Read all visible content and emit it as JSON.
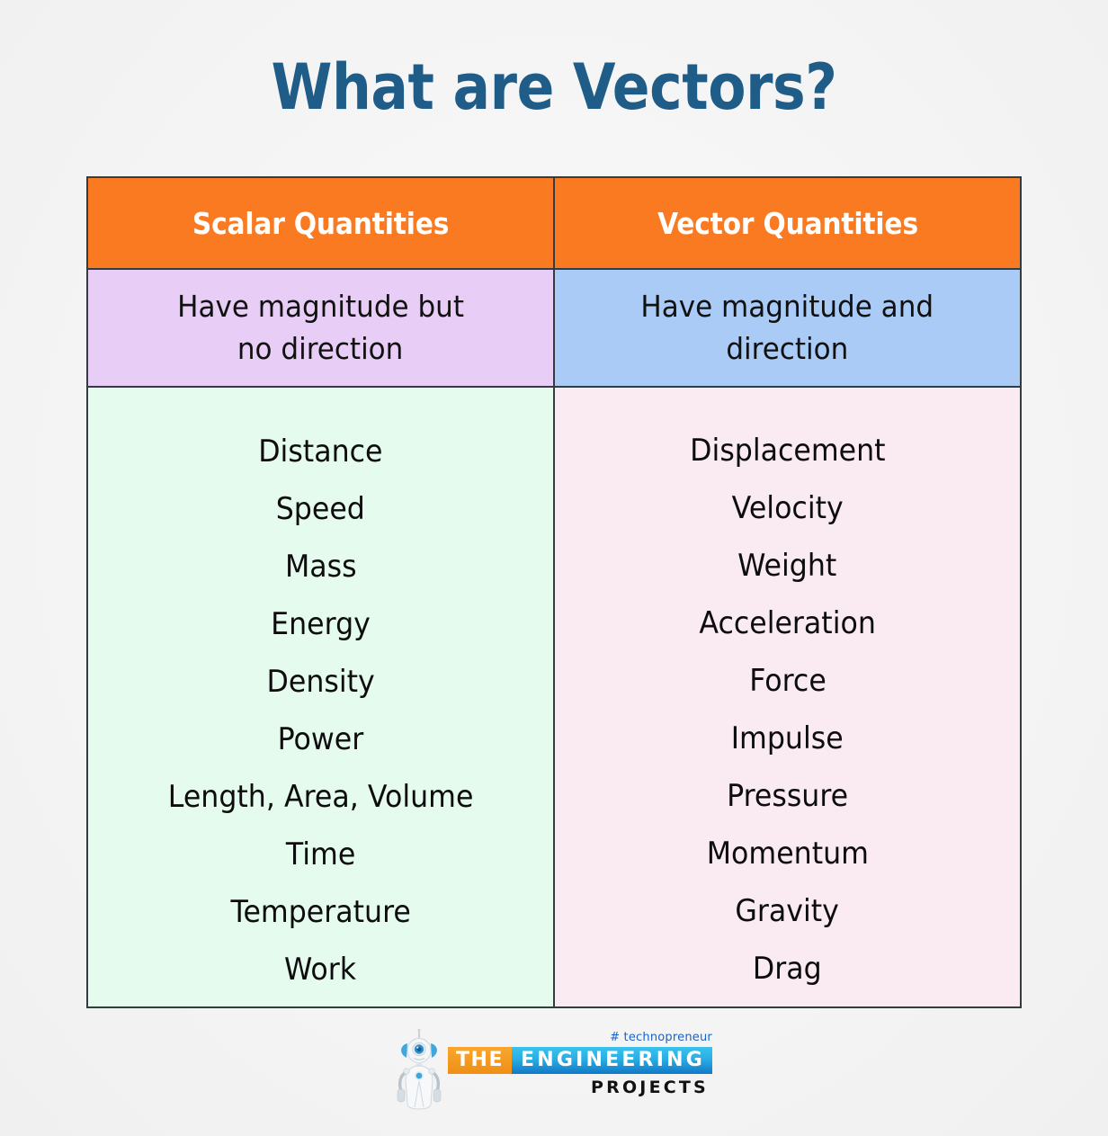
{
  "page": {
    "title": "What are Vectors?",
    "title_color": "#1f5c87",
    "background_color": "#f5f5f5"
  },
  "colors": {
    "header_orange": "#f97a20",
    "scalar_definition_bg": "#e8cdf7",
    "vector_definition_bg": "#a9cbf6",
    "scalar_list_bg": "#e4fbee",
    "vector_list_bg": "#faeaf2",
    "border": "#333c3e",
    "body_text": "#0d0d0d",
    "logo_orange": "#f9a62c",
    "logo_blue": "#1278c6",
    "hashtag_blue": "#1664c8"
  },
  "chart_data": {
    "type": "table",
    "title": "What are Vectors?",
    "columns": [
      "Scalar Quantities",
      "Vector Quantities"
    ],
    "definitions": [
      "Have magnitude but no direction",
      "Have magnitude and direction"
    ],
    "rows": [
      [
        "Distance",
        "Displacement"
      ],
      [
        "Speed",
        "Velocity"
      ],
      [
        "Mass",
        "Weight"
      ],
      [
        "Energy",
        "Acceleration"
      ],
      [
        "Density",
        "Force"
      ],
      [
        "Power",
        "Impulse"
      ],
      [
        "Length, Area, Volume",
        "Pressure"
      ],
      [
        "Time",
        "Momentum"
      ],
      [
        "Temperature",
        "Gravity"
      ],
      [
        "Work",
        "Drag"
      ]
    ]
  },
  "table": {
    "headers": {
      "scalar": "Scalar Quantities",
      "vector": "Vector Quantities"
    },
    "definitions": {
      "scalar_line1": "Have magnitude but",
      "scalar_line2": "no direction",
      "vector_line1": "Have magnitude and",
      "vector_line2": "direction"
    },
    "scalar_items": [
      "Distance",
      "Speed",
      "Mass",
      "Energy",
      "Density",
      "Power",
      "Length, Area, Volume",
      "Time",
      "Temperature",
      "Work"
    ],
    "vector_items": [
      "Displacement",
      "Velocity",
      "Weight",
      "Acceleration",
      "Force",
      "Impulse",
      "Pressure",
      "Momentum",
      "Gravity",
      "Drag"
    ]
  },
  "footer": {
    "hashtag": "# technopreneur",
    "brand_the": "THE",
    "brand_engineering": "ENGINEERING",
    "brand_projects": "PROJECTS"
  }
}
